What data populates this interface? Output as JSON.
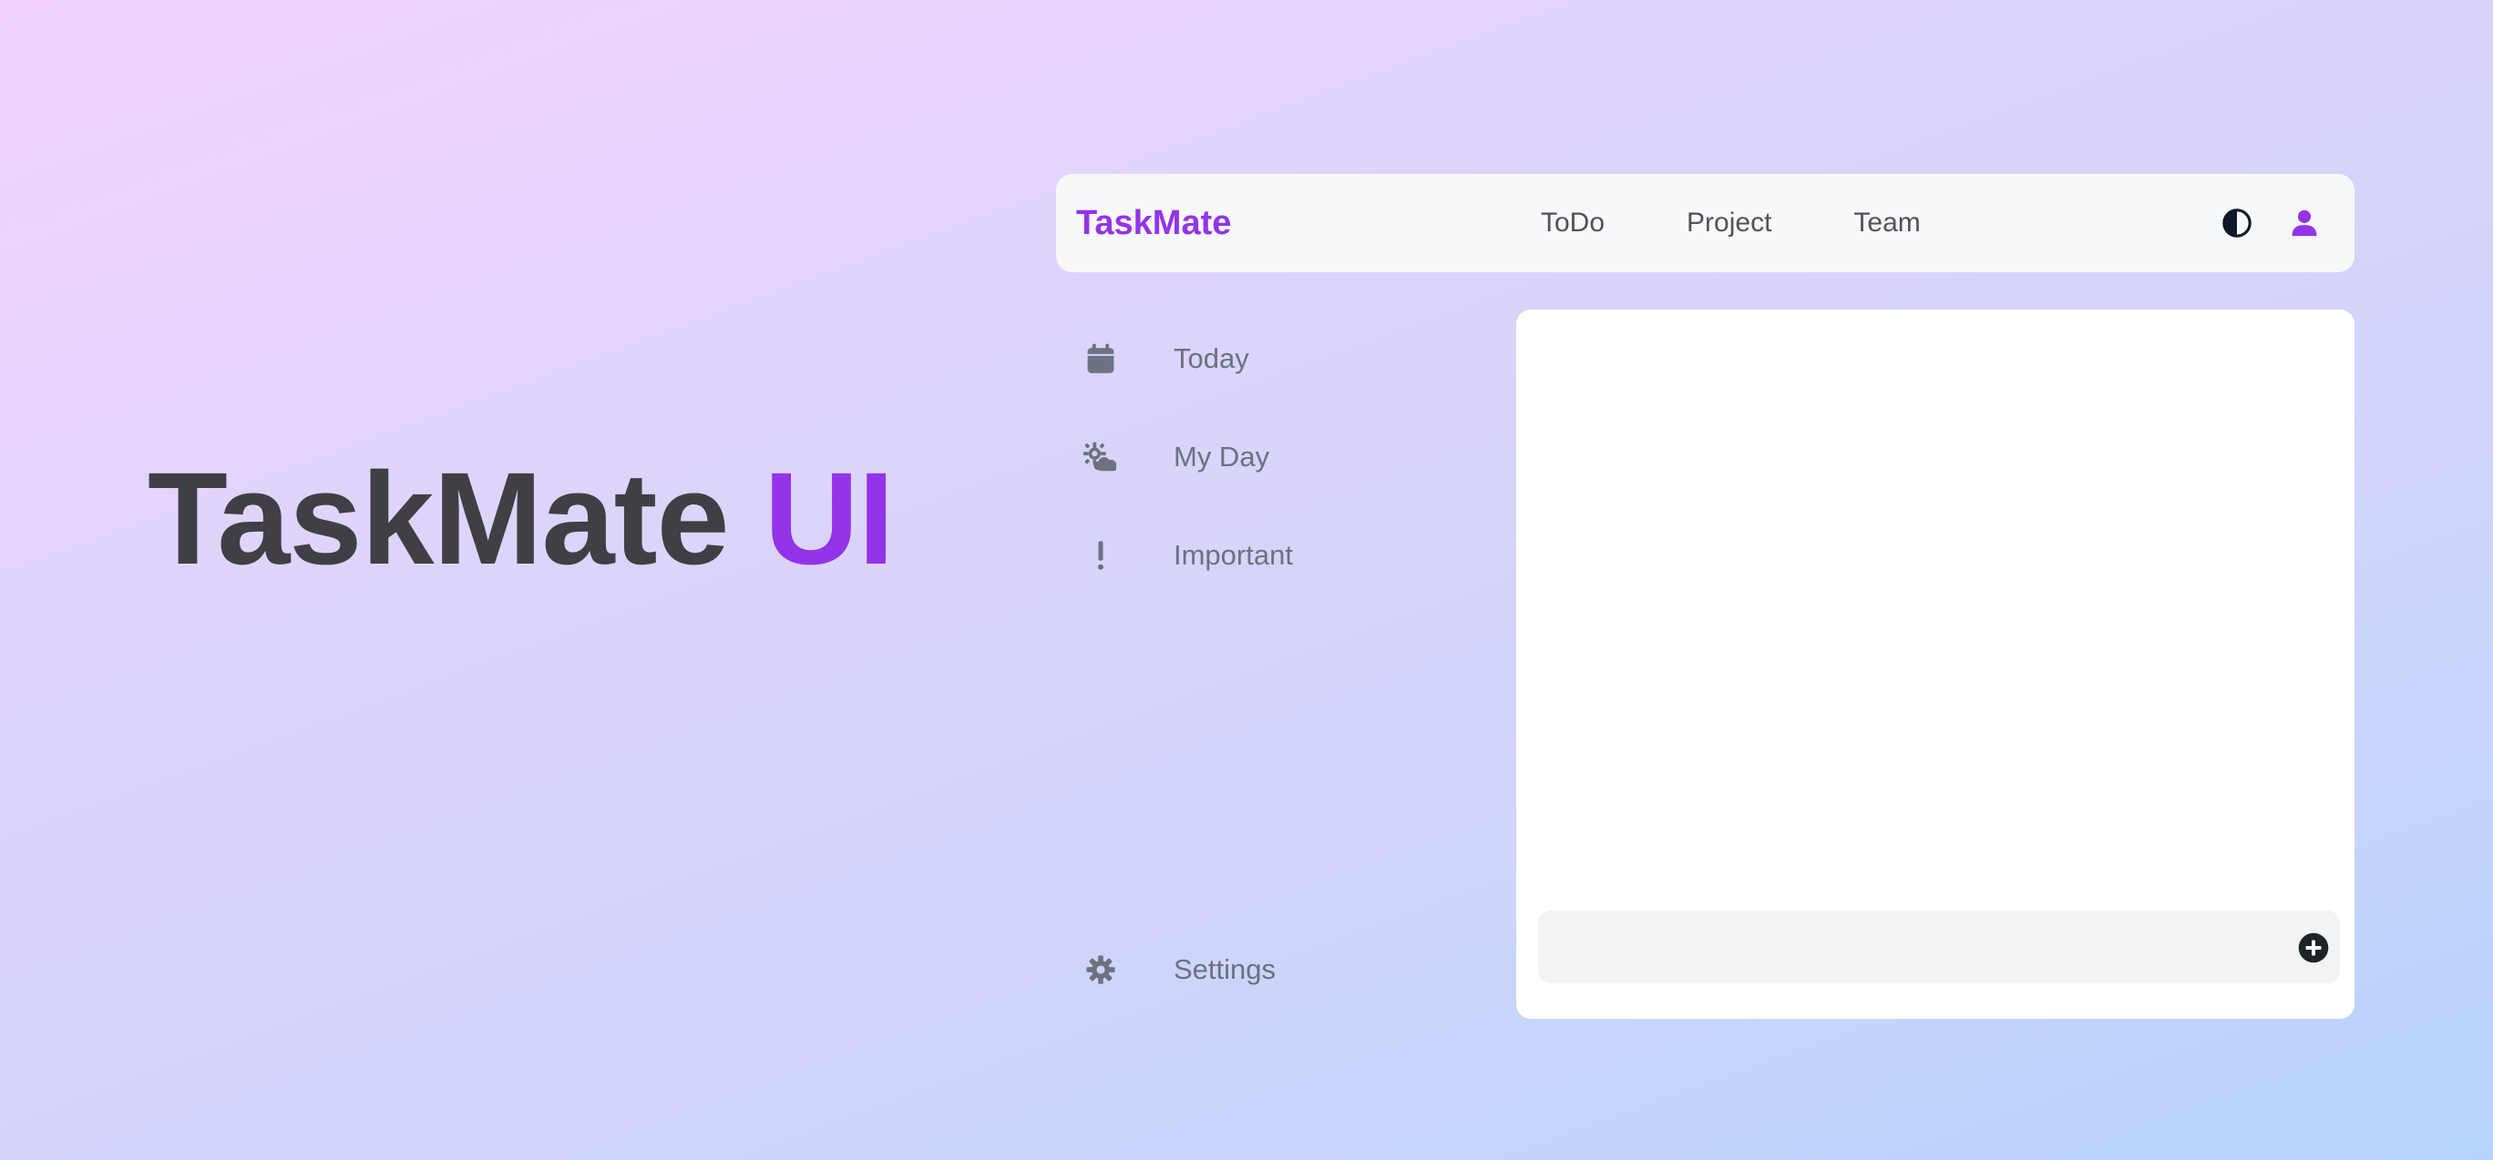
{
  "hero": {
    "title_main": "TaskMate",
    "title_accent": "UI"
  },
  "navbar": {
    "brand": "TaskMate",
    "links": [
      {
        "label": "ToDo"
      },
      {
        "label": "Project"
      },
      {
        "label": "Team"
      }
    ],
    "icons": [
      "theme-toggle-icon",
      "user-icon"
    ]
  },
  "sidebar": {
    "items": [
      {
        "label": "Today",
        "icon": "calendar-icon"
      },
      {
        "label": "My Day",
        "icon": "sun-cloud-icon"
      },
      {
        "label": "Important",
        "icon": "exclamation-icon"
      }
    ],
    "settings": {
      "label": "Settings",
      "icon": "gear-icon"
    }
  },
  "task_panel": {
    "input_value": "",
    "input_placeholder": "",
    "add_icon": "plus-circle-icon"
  },
  "colors": {
    "accent": "#9333ea",
    "text_dark": "#3f3f46",
    "text_muted": "#6b7280",
    "navbar_bg": "#f7f8fa",
    "panel_bg": "#ffffff",
    "input_bg": "#f3f3f3"
  }
}
